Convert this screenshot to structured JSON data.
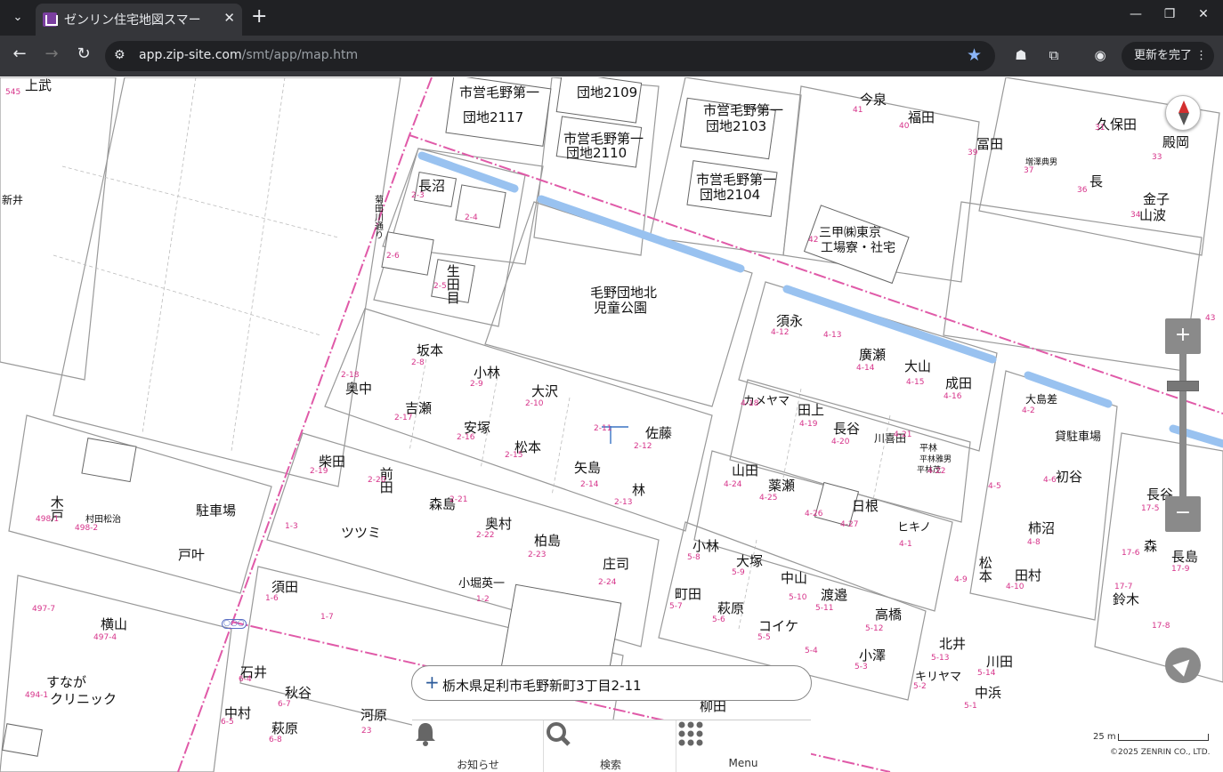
{
  "browser": {
    "tab_title": "ゼンリン住宅地図スマー",
    "url_host": "app.zip-site.com",
    "url_path": "/smt/app/map.htm",
    "update_label": "更新を完了"
  },
  "map": {
    "labels": [
      "上武",
      "新井",
      "長沼",
      "生田目",
      "毛野団地北",
      "児童公園",
      "坂本",
      "小林",
      "大沢",
      "奥中",
      "吉瀬",
      "安塚",
      "松本",
      "矢島",
      "林",
      "佐藤",
      "柴田",
      "前田",
      "森島",
      "ツツミ",
      "奥村",
      "柏島",
      "庄司",
      "須田",
      "小堀英一",
      "木戸",
      "村田松治",
      "駐車場",
      "戸叶",
      "横山",
      "すなが",
      "クリニック",
      "石井",
      "秋谷",
      "中村",
      "萩原",
      "河原",
      "須永",
      "廣瀬",
      "大山",
      "成田",
      "カメヤマ",
      "田上",
      "長谷",
      "川喜田",
      "平林",
      "山田",
      "薬瀬",
      "日根",
      "ヒキノ",
      "小林",
      "大塚",
      "中山",
      "渡邉",
      "町田",
      "萩原",
      "コイケ",
      "高橋",
      "小澤",
      "北井",
      "キリヤマ",
      "中浜",
      "川田",
      "大島差",
      "貸駐車場",
      "初谷",
      "柿沼",
      "松本",
      "田村",
      "今泉",
      "福田",
      "冨田",
      "久保田",
      "殿岡",
      "長",
      "金子",
      "山波",
      "三甲㈱東京",
      "工場寮・社宅",
      "長谷",
      "森",
      "長島",
      "鈴木",
      "柳田",
      "増澤典男",
      "平林雅男",
      "平林茂"
    ],
    "buildings": [
      "市営毛野第一",
      "団地2117",
      "団地2109",
      "市営毛野第一",
      "団地2110",
      "市営毛野第一",
      "団地2103",
      "市営毛野第一",
      "団地2104"
    ],
    "nums": [
      "545",
      "2-3",
      "2-4",
      "2-6",
      "2-5",
      "2-8",
      "2-18",
      "2-9",
      "2-10",
      "2-11",
      "2-17",
      "2-16",
      "2-15",
      "2-14",
      "2-12",
      "2-13",
      "2-19",
      "2-20",
      "2-21",
      "2-22",
      "2-23",
      "2-24",
      "1-3",
      "1-6",
      "1-7",
      "1-2",
      "498-1",
      "498-2",
      "497-7",
      "497-4",
      "494-1",
      "6-4",
      "6-7",
      "6-5",
      "6-8",
      "23",
      "4-12",
      "4-13",
      "4-14",
      "4-15",
      "4-16",
      "4-18",
      "4-19",
      "4-20",
      "4-21",
      "4-22",
      "4-24",
      "4-25",
      "4-26",
      "4-27",
      "4-1",
      "5-8",
      "5-9",
      "5-10",
      "5-11",
      "5-7",
      "5-6",
      "5-5",
      "5-4",
      "5-12",
      "5-3",
      "5-13",
      "5-14",
      "5-2",
      "5-1",
      "4-2",
      "4-5",
      "4-6",
      "4-8",
      "4-9",
      "4-10",
      "41",
      "40",
      "39",
      "37",
      "36",
      "34",
      "33",
      "31",
      "42",
      "43",
      "17-5",
      "17-6",
      "17-9",
      "17-7",
      "17-8"
    ],
    "road_label": "菊田川通り",
    "marker": "○○○"
  },
  "controls": {
    "zoom_in": "+",
    "zoom_out": "−"
  },
  "address_bar": {
    "address": "栃木県足利市毛野新町3丁目2-11"
  },
  "bottom_nav": [
    {
      "label": "お知らせ",
      "icon": "bell-icon"
    },
    {
      "label": "検索",
      "icon": "search-icon"
    },
    {
      "label": "Menu",
      "icon": "grid-icon"
    }
  ],
  "scale_label": "25 m",
  "copyright": "©2025 ZENRIN CO., LTD."
}
